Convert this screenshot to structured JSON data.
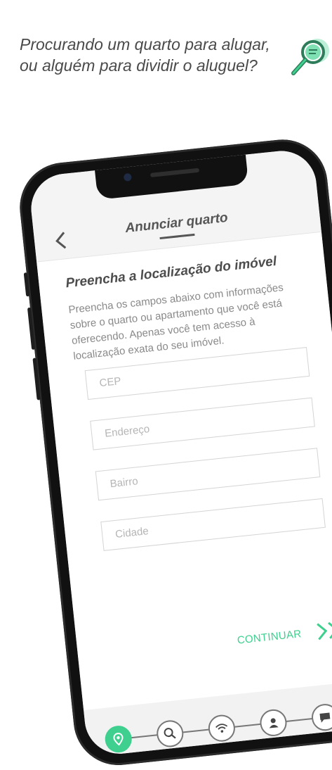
{
  "headline": {
    "line1": "Procurando um quarto para alugar,",
    "line2": "ou alguém para dividir o aluguel?"
  },
  "appbar": {
    "back_icon": "chevron-left-icon",
    "title": "Anunciar quarto"
  },
  "form": {
    "title": "Preencha a localização do imóvel",
    "description": "Preencha os campos abaixo com informações sobre o quarto ou apartamento que você está oferecendo. Apenas você tem acesso à localização exata do seu imóvel.",
    "fields": [
      {
        "placeholder": "CEP",
        "value": ""
      },
      {
        "placeholder": "Endereço",
        "value": ""
      },
      {
        "placeholder": "Bairro",
        "value": ""
      },
      {
        "placeholder": "Cidade",
        "value": ""
      }
    ],
    "continue_label": "CONTINUAR"
  },
  "stepper": {
    "steps": [
      "location-pin-icon",
      "search-icon",
      "wifi-icon",
      "person-icon",
      "chat-bubble-icon"
    ],
    "active_step": 1
  },
  "colors": {
    "accent": "#3fcf8e",
    "text_dark": "#4a4a4a",
    "text_muted": "#8a8a8a"
  }
}
